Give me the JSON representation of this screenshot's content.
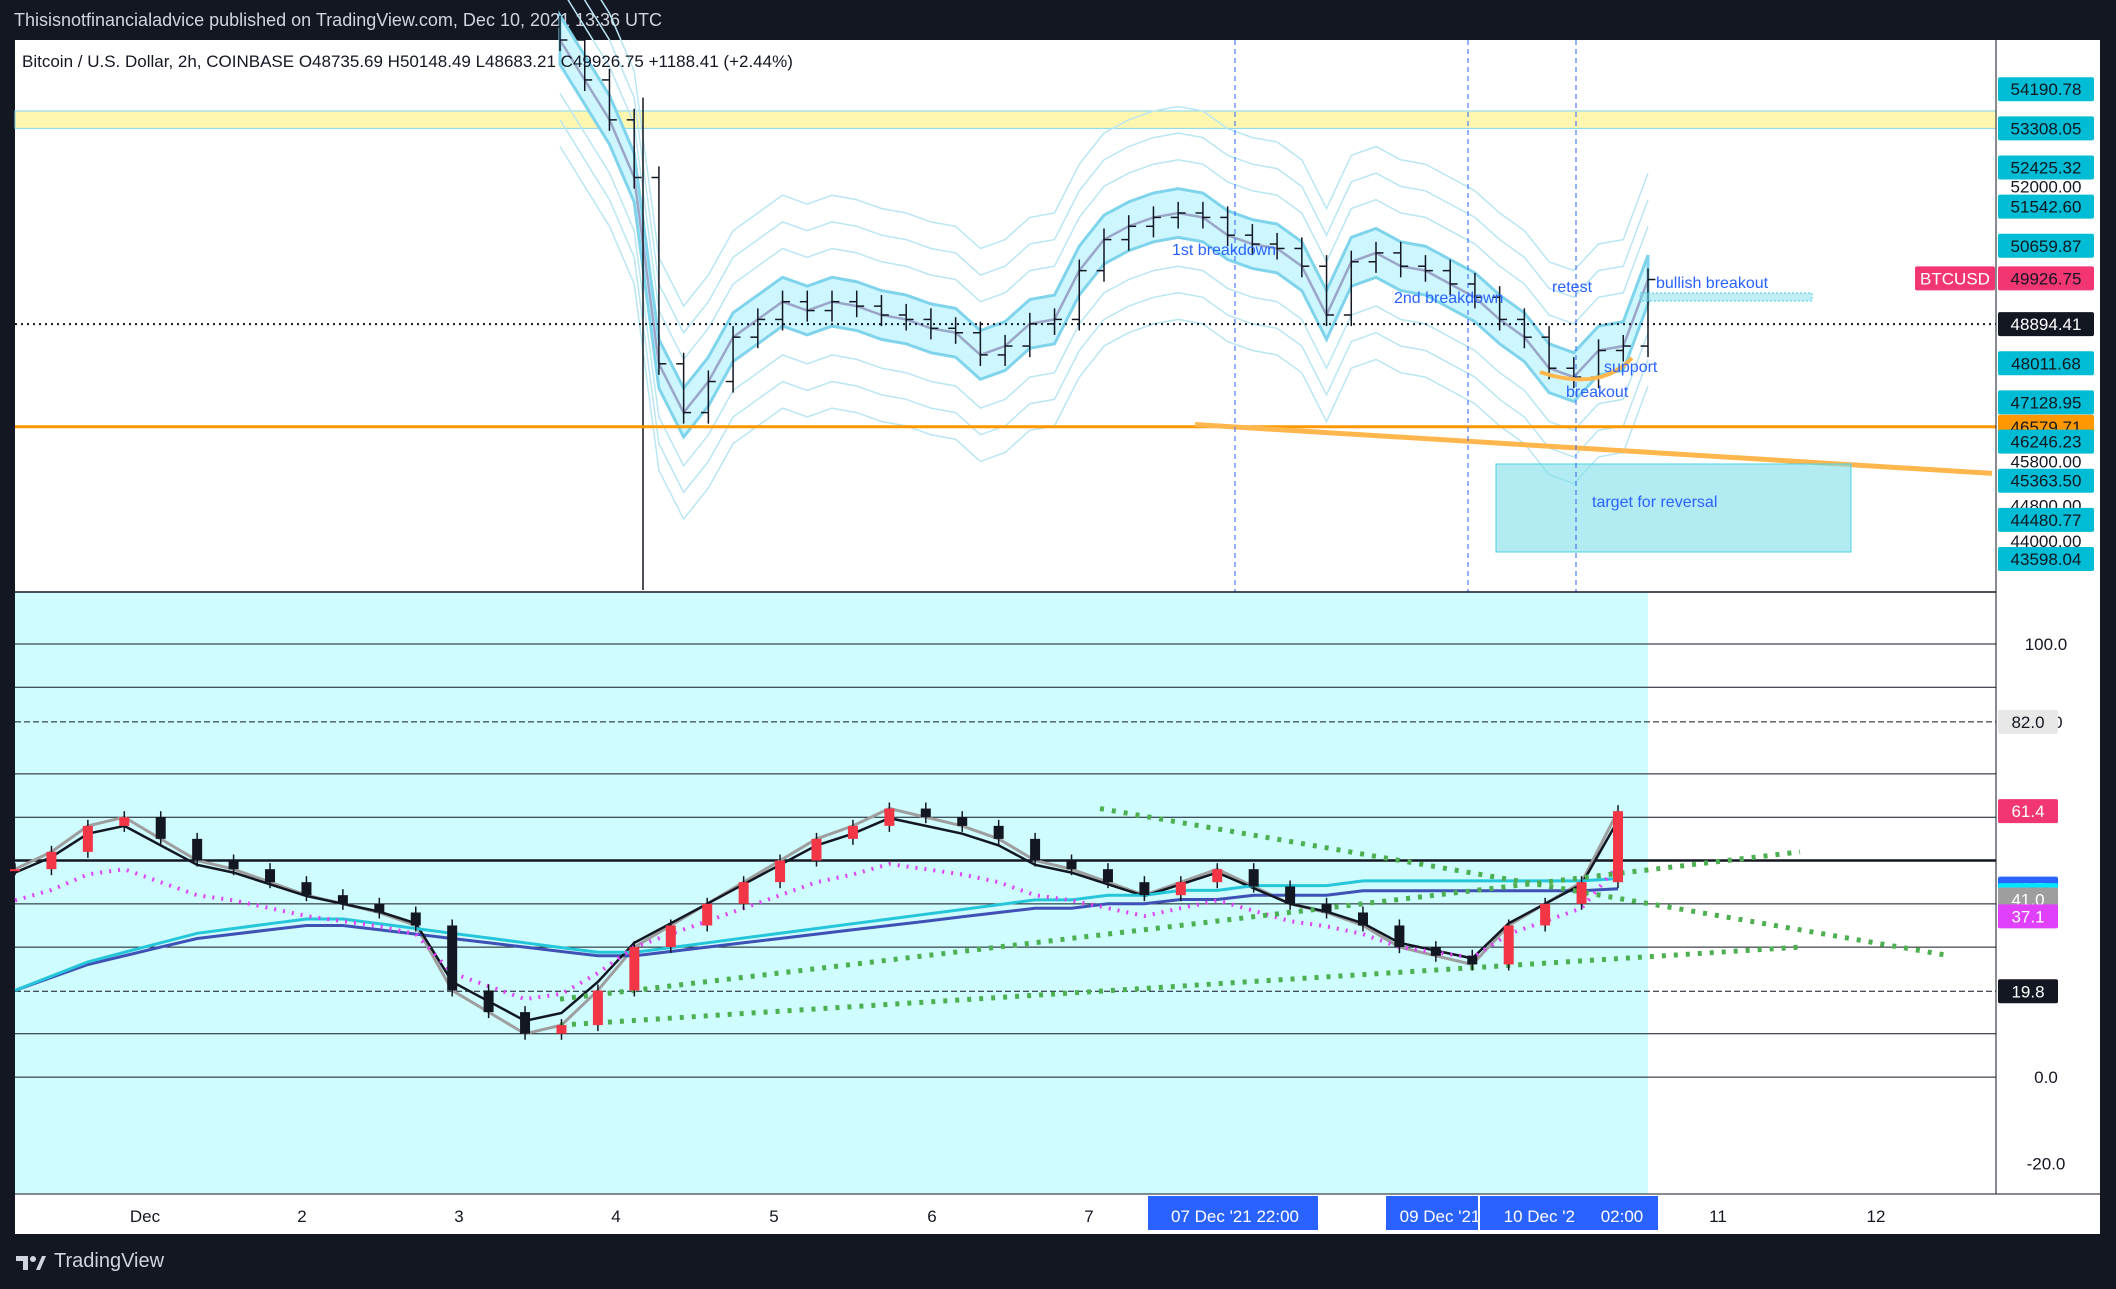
{
  "header": {
    "published": "Thisisnotfinancialadvice published on TradingView.com, Dec 10, 2021 13:36 UTC"
  },
  "symbol_line": "Bitcoin / U.S. Dollar, 2h, COINBASE  O48735.69  H50148.49  L48683.21  C49926.75  +1188.41 (+2.44%)",
  "footer": {
    "brand": "TradingView"
  },
  "colors": {
    "cyan_fill": "#cefcff",
    "ema_band": "#7fd4ec",
    "orange": "#ff9800",
    "pink": "#f23671",
    "blue": "#2962ff",
    "green": "#4caf50"
  },
  "chart_data": [
    {
      "type": "candlestick",
      "title": "",
      "ylim": [
        42900,
        55300
      ],
      "price_tags": [
        "54190.78",
        "53308.05",
        "52425.32",
        "52000.00",
        "51542.60",
        "50659.87",
        "49926.75",
        "48894.41",
        "48011.68",
        "47128.95",
        "46579.71",
        "46246.23",
        "45800.00",
        "45363.50",
        "44800.00",
        "44480.77",
        "44000.00",
        "43598.04"
      ],
      "highlighted_tags": [
        {
          "label": "BTCUSD",
          "value": "49926.75",
          "color": "#f23671"
        },
        {
          "value": "48894.41",
          "color": "#131722"
        },
        {
          "value": "46579.71",
          "color": "#ff9800"
        }
      ],
      "levels": {
        "yellow_zone": [
          53308.05,
          53700
        ],
        "dotted_line": 48894.41,
        "orange_line": 46579.71
      },
      "annotations": [
        "1st breakdown",
        "2nd breakdown",
        "retest",
        "bullish breakout",
        "support",
        "breakout",
        "target for reversal"
      ],
      "close_series": [
        55300,
        54400,
        53500,
        52200,
        48000,
        46900,
        47600,
        48600,
        49000,
        49400,
        49200,
        49400,
        49300,
        49100,
        49000,
        48800,
        48700,
        48200,
        48400,
        48900,
        49000,
        50100,
        50800,
        51100,
        51300,
        51400,
        51300,
        50900,
        50700,
        50600,
        50200,
        49100,
        50300,
        50500,
        50200,
        50100,
        49800,
        49500,
        49000,
        48600,
        47900,
        47700,
        48300,
        48400,
        49900
      ]
    },
    {
      "type": "line",
      "title": "",
      "ylim": [
        -27,
        112
      ],
      "y_ticks": [
        "100.0",
        "82.0",
        "0.0",
        "-20.0"
      ],
      "value_tags": [
        {
          "value": "82.0",
          "color": "#e8e8e8",
          "text": "#131722"
        },
        {
          "value": "61.4",
          "color": "#f23671",
          "text": "#ffffff"
        },
        {
          "value": "43.5",
          "color": "#2962ff",
          "text": "#ffffff"
        },
        {
          "value": "42.0",
          "color": "#00e5ff",
          "text": "#131722"
        },
        {
          "value": "41.0",
          "color": "#9e9e9e",
          "text": "#ffffff"
        },
        {
          "value": "37.1",
          "color": "#e040fb",
          "text": "#ffffff"
        },
        {
          "value": "19.8",
          "color": "#131722",
          "text": "#ffffff"
        }
      ],
      "x_ticks": [
        "Dec",
        "2",
        "3",
        "4",
        "5",
        "6",
        "7",
        "07 Dec '21   22:00",
        "09 Dec '21",
        "10 Dec '21",
        "02:00",
        "11",
        "12"
      ],
      "series": [
        {
          "values": [
            48,
            52,
            58,
            60,
            55,
            50,
            48,
            45,
            42,
            40,
            38,
            35,
            20,
            15,
            10,
            12,
            20,
            30,
            35,
            40,
            45,
            50,
            55,
            58,
            62,
            60,
            58,
            55,
            50,
            48,
            45,
            42,
            45,
            48,
            44,
            40,
            38,
            35,
            30,
            28,
            26,
            35,
            40,
            45,
            61.4
          ]
        },
        {
          "values": [
            20,
            23,
            26,
            28,
            30,
            32,
            33,
            34,
            35,
            35,
            34,
            33,
            32,
            31,
            30,
            29,
            28,
            28,
            29,
            30,
            31,
            32,
            33,
            34,
            35,
            36,
            37,
            38,
            39,
            39,
            40,
            40,
            41,
            41,
            42,
            42,
            42,
            43,
            43,
            43,
            43,
            43,
            43,
            43,
            43.5
          ]
        }
      ]
    }
  ]
}
